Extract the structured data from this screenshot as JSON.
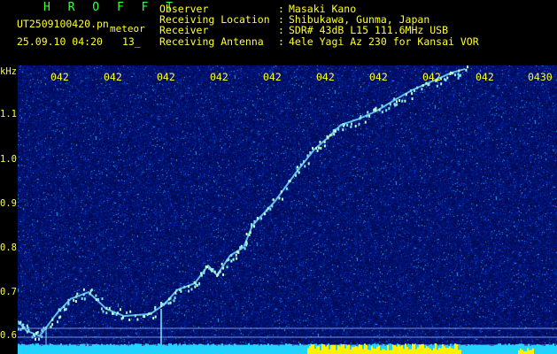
{
  "header": {
    "brand": "H R O F F T",
    "file_name": "UT2509100420.pn",
    "mode": "meteor",
    "date_time": "25.09.10 04:20",
    "count": "13_"
  },
  "info": [
    {
      "key": "Observer",
      "value": "Masaki Kano"
    },
    {
      "key": "Receiving Location",
      "value": "Shibukawa, Gunma, Japan"
    },
    {
      "key": "Receiver",
      "value": "SDR# 43dB L15 111.6MHz USB"
    },
    {
      "key": "Receiving Antenna",
      "value": "4ele Yagi Az 230 for Kansai VOR"
    }
  ],
  "separator": ":",
  "axis": {
    "y_unit": "kHz",
    "y_labels": [
      "1.1",
      "1.0",
      "0.9",
      "0.8",
      "0.7",
      "0.6"
    ],
    "time_labels": [
      "042",
      "042",
      "042",
      "042",
      "042",
      "042",
      "042",
      "042",
      "042",
      "0430"
    ]
  },
  "colors": {
    "background": "#001070",
    "header_text": "#ffff2a",
    "brand": "#39ff3c",
    "trace": "#7de8ff",
    "baseline": "#22d3ff",
    "burst": "#fff200"
  }
}
